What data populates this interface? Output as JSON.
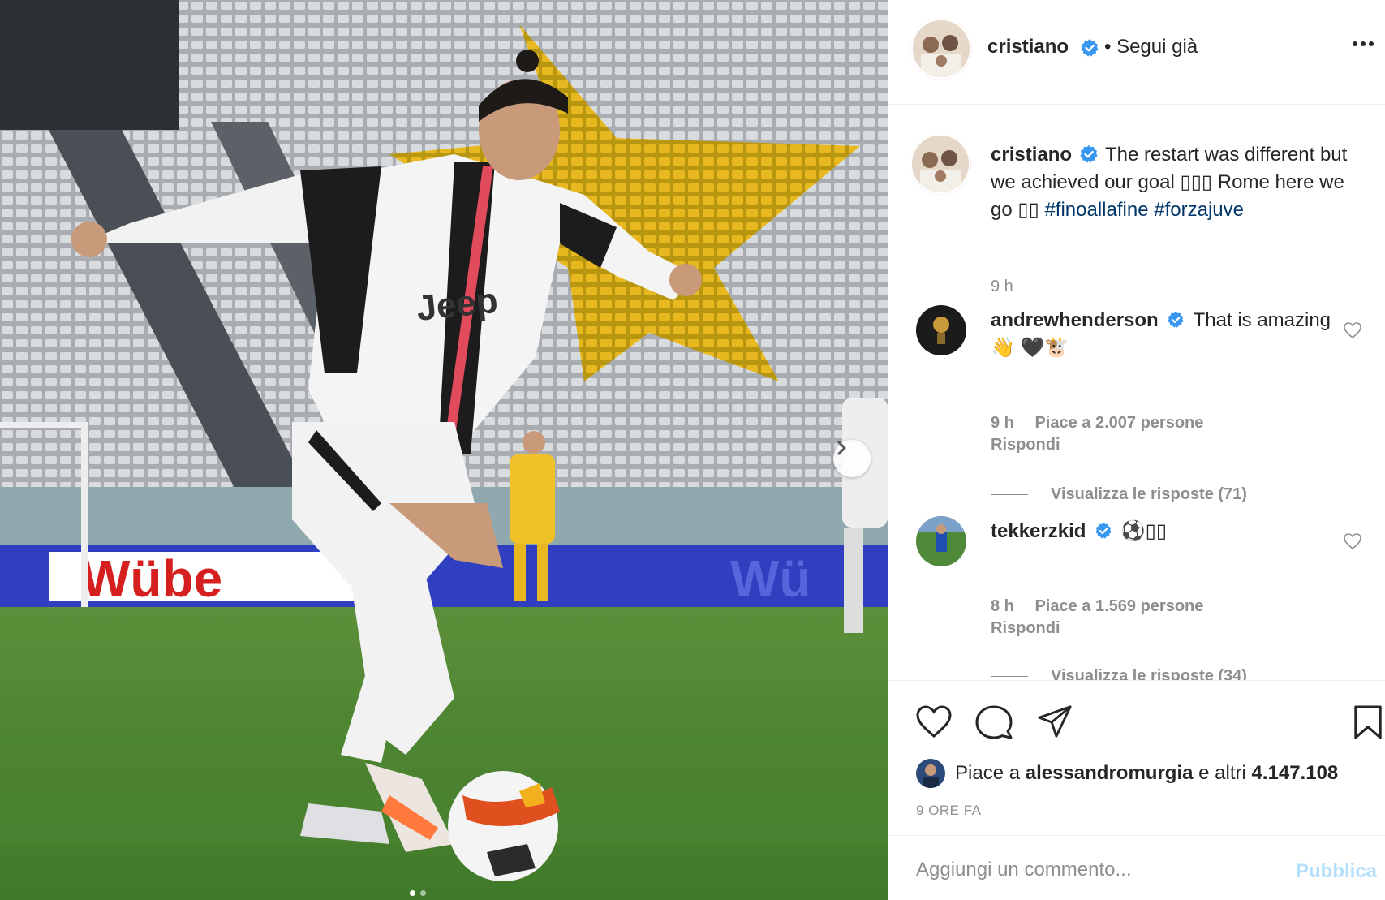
{
  "post": {
    "author": "cristiano",
    "follow_state": "• Segui già",
    "caption_text": "The restart was different but we achieved our goal ▯▯▯ Rome here we go ▯▯",
    "hashtag_1": "#finoallafine",
    "hashtag_2": "#forzajuve",
    "caption_time": "9 h",
    "photo_description": "football-player-dribbling-photo",
    "carousel_slide": 1,
    "carousel_total": 2
  },
  "comments": [
    {
      "username": "andrewhenderson",
      "text": "That is amazing 👋 🖤🐮",
      "time": "9 h",
      "likes": "Piace a 2.007 persone",
      "reply": "Rispondi",
      "view_replies": "Visualizza le risposte (71)"
    },
    {
      "username": "tekkerzkid",
      "text": "⚽▯▯",
      "time": "8 h",
      "likes": "Piace a 1.569 persone",
      "reply": "Rispondi",
      "view_replies": "Visualizza le risposte (34)"
    }
  ],
  "likes_summary": {
    "prefix": "Piace a ",
    "user": "alessandromurgia",
    "suffix": " e altri ",
    "count": "4.147.108"
  },
  "time_ago": "9 ORE FA",
  "comment_box": {
    "placeholder": "Aggiungi un commento...",
    "publish": "Pubblica"
  },
  "icons": {
    "verified": "verified-badge-icon",
    "more": "more-options-icon",
    "heart": "heart-icon",
    "comment": "comment-icon",
    "share": "share-icon",
    "save": "bookmark-icon",
    "next": "chevron-right-icon"
  },
  "colors": {
    "verified_blue": "#3897f0",
    "hashtag": "#00376b",
    "meta_gray": "#8e8e8e",
    "publish_disabled": "#b2dffc"
  }
}
